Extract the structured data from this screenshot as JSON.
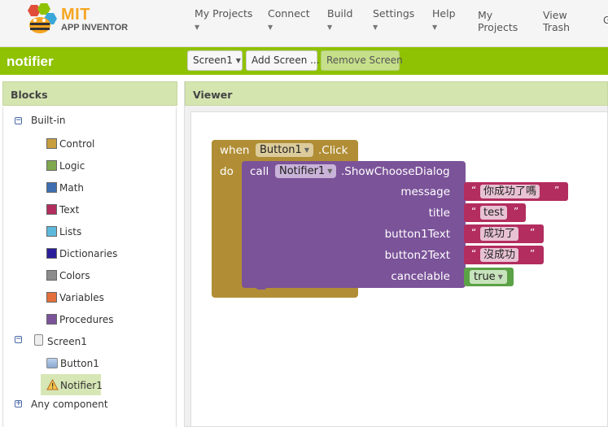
{
  "logo": {
    "title": "MIT",
    "subtitle": "APP INVENTOR"
  },
  "nav": {
    "items": [
      {
        "label": "My Projects",
        "has_dropdown": true
      },
      {
        "label": "Connect",
        "has_dropdown": true
      },
      {
        "label": "Build",
        "has_dropdown": true
      },
      {
        "label": "Settings",
        "has_dropdown": true
      },
      {
        "label": "Help",
        "has_dropdown": true
      }
    ],
    "links": [
      {
        "line1": "My",
        "line2": "Projects"
      },
      {
        "line1": "View",
        "line2": "Trash"
      }
    ],
    "overflow_label": "G"
  },
  "project": {
    "name": "notifier",
    "screen_select": "Screen1",
    "add_screen": "Add Screen ...",
    "remove_screen": "Remove Screen"
  },
  "blocks_panel": {
    "title": "Blocks",
    "builtin_label": "Built-in",
    "builtin": [
      {
        "label": "Control",
        "color": "#c79e3e"
      },
      {
        "label": "Logic",
        "color": "#7fa84f"
      },
      {
        "label": "Math",
        "color": "#3f6fb0"
      },
      {
        "label": "Text",
        "color": "#b32d5e"
      },
      {
        "label": "Lists",
        "color": "#5db9dc"
      },
      {
        "label": "Dictionaries",
        "color": "#2b1e9a"
      },
      {
        "label": "Colors",
        "color": "#8c8c8c"
      },
      {
        "label": "Variables",
        "color": "#e3703c"
      },
      {
        "label": "Procedures",
        "color": "#7b5399"
      }
    ],
    "screen_label": "Screen1",
    "components": [
      {
        "label": "Button1",
        "icon": "button-icon"
      },
      {
        "label": "Notifier1",
        "icon": "warning-icon",
        "selected": true
      }
    ],
    "any_component_label": "Any component"
  },
  "viewer": {
    "title": "Viewer",
    "event": {
      "when": "when",
      "component": "Button1",
      "event_name": ".Click",
      "do": "do"
    },
    "call": {
      "call": "call",
      "component": "Notifier1",
      "method": ".ShowChooseDialog",
      "params": [
        {
          "name": "message",
          "value": "你成功了嗎"
        },
        {
          "name": "title",
          "value": "test"
        },
        {
          "name": "button1Text",
          "value": "成功了"
        },
        {
          "name": "button2Text",
          "value": "沒成功"
        },
        {
          "name": "cancelable",
          "value": "true"
        }
      ]
    }
  }
}
